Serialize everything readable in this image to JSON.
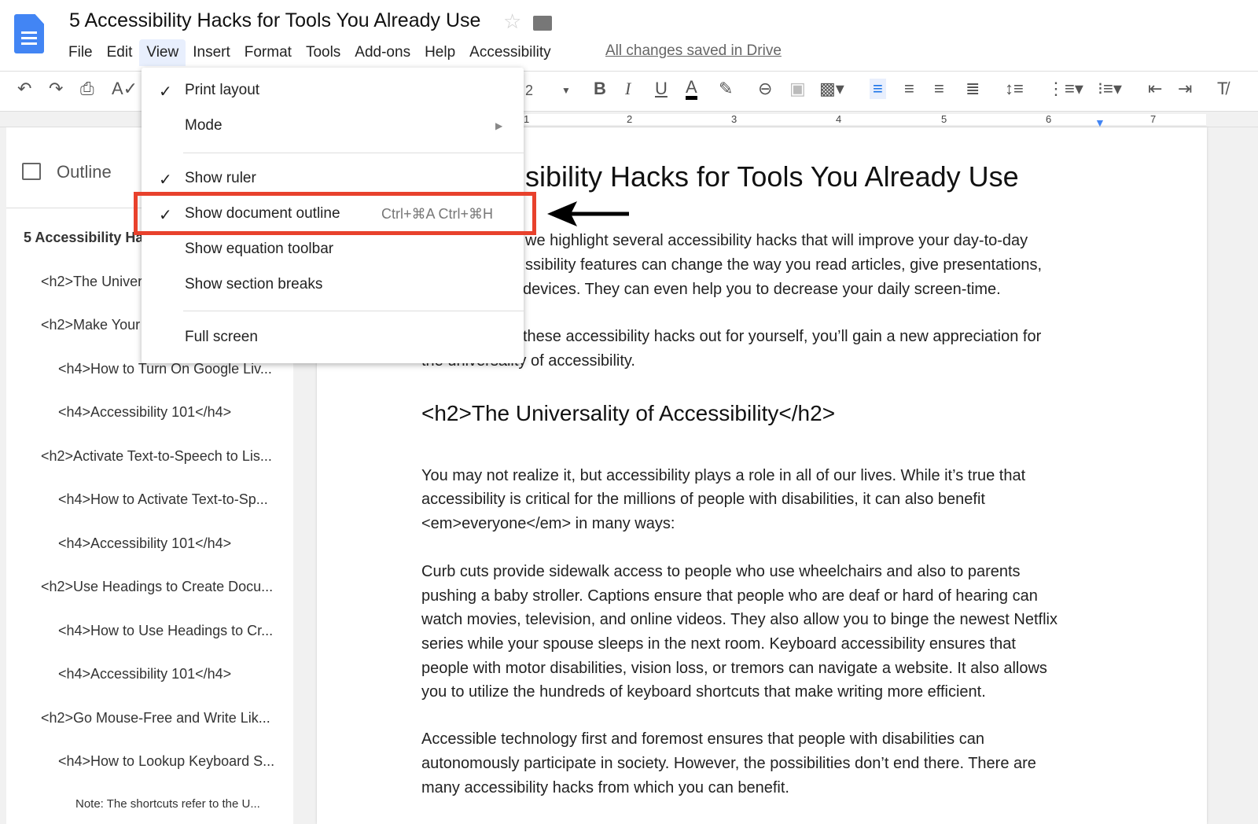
{
  "app": {
    "title": "5 Accessibility Hacks for Tools You Already Use",
    "saved_status": "All changes saved in Drive"
  },
  "menubar": [
    "File",
    "Edit",
    "View",
    "Insert",
    "Format",
    "Tools",
    "Add-ons",
    "Help",
    "Accessibility"
  ],
  "toolbar": {
    "font_size_partial": "2"
  },
  "ruler": [
    "1",
    "2",
    "3",
    "4",
    "5",
    "6",
    "7"
  ],
  "view_menu": {
    "items": [
      {
        "label": "Print layout",
        "checked": true
      },
      {
        "label": "Mode",
        "submenu": true
      },
      {
        "label": "Show ruler",
        "checked": true
      },
      {
        "label": "Show document outline",
        "checked": true,
        "shortcut": "Ctrl+⌘A Ctrl+⌘H",
        "highlighted": true
      },
      {
        "label": "Show equation toolbar"
      },
      {
        "label": "Show section breaks"
      },
      {
        "label": "Full screen"
      }
    ]
  },
  "outline": {
    "title": "Outline",
    "items": [
      "5 Accessibility Ha",
      "<h2>The Univer",
      "<h2>Make Your",
      "<h4>How to Turn On Google Liv...",
      "<h4>Accessibility 101</h4>",
      "<h2>Activate Text-to-Speech to Lis...",
      "<h4>How to Activate Text-to-Sp...",
      "<h4>Accessibility 101</h4>",
      "<h2>Use Headings to Create Docu...",
      "<h4>How to Use Headings to Cr...",
      "<h4>Accessibility 101</h4>",
      "<h2>Go Mouse-Free and Write Lik...",
      "<h4>How to Lookup Keyboard S...",
      "Note: The shortcuts refer to the U..."
    ]
  },
  "document": {
    "title_visible": "sibility Hacks for Tools You Already Use",
    "intro_lines": [
      "we highlight several accessibility hacks that will improve your day-to-day",
      "ssibility features can change the way you read articles, give presentations,",
      "devices. They can even help you to decrease your daily screen-time."
    ],
    "p2_lines": [
      "these accessibility hacks out for yourself, you’ll gain a new appreciation for",
      "the universality of accessibility."
    ],
    "h2": "<h2>The Universality of Accessibility</h2>",
    "p3_lines": [
      "You may not realize it, but accessibility plays a role in all of our lives. While it’s true that",
      "accessibility is critical for the millions of people with disabilities, it can also benefit",
      "<em>everyone</em> in many ways:"
    ],
    "p4_lines": [
      "Curb cuts provide sidewalk access to people who use wheelchairs and also to parents",
      "pushing a baby stroller. Captions ensure that people who are deaf or hard of hearing can",
      "watch movies, television, and online videos. They also allow you to binge the newest Netflix",
      "series while your spouse sleeps in the next room. Keyboard accessibility ensures that",
      "people with motor disabilities, vision loss, or tremors can navigate a website. It also allows",
      "you to utilize the hundreds of keyboard shortcuts that make writing more efficient."
    ],
    "p5_lines": [
      "Accessible technology first and foremost ensures that people with disabilities can",
      "autonomously participate in society. However, the possibilities don’t end there. There are",
      "many accessibility hacks from which you can benefit."
    ]
  },
  "colors": {
    "highlight_box": "#e8412c",
    "docs_blue": "#4285f4"
  }
}
